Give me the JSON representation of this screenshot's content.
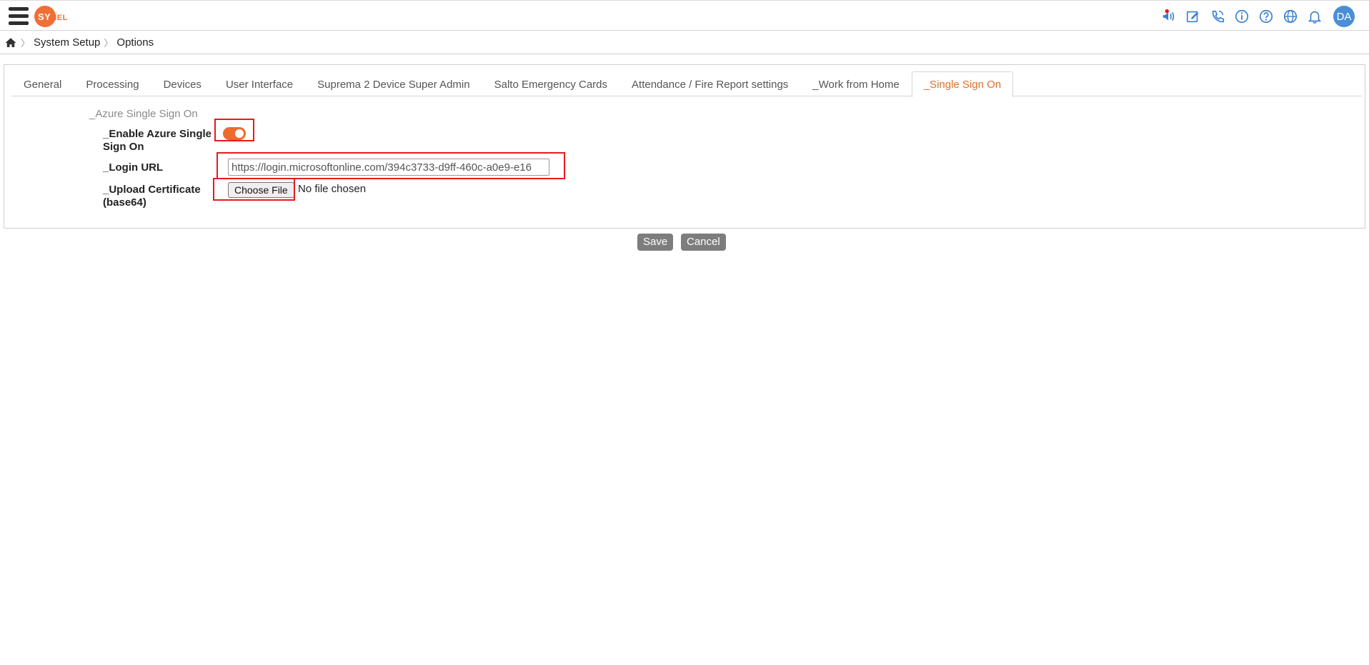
{
  "header": {
    "logo_text": "SY",
    "logo_tail": "NEL",
    "icons": [
      "announcement-icon",
      "edit-note-icon",
      "phone-icon",
      "info-icon",
      "help-icon",
      "globe-icon",
      "bell-icon"
    ],
    "avatar_initials": "DA",
    "accent_color": "#f06f35",
    "avatar_color": "#4a8fd6"
  },
  "breadcrumb": {
    "items": [
      "System Setup",
      "Options"
    ]
  },
  "tabs": [
    {
      "label": "General",
      "active": false
    },
    {
      "label": "Processing",
      "active": false
    },
    {
      "label": "Devices",
      "active": false
    },
    {
      "label": "User Interface",
      "active": false
    },
    {
      "label": "Suprema 2 Device Super Admin",
      "active": false
    },
    {
      "label": "Salto Emergency Cards",
      "active": false
    },
    {
      "label": "Attendance / Fire Report settings",
      "active": false
    },
    {
      "label": "_Work from Home",
      "active": false
    },
    {
      "label": "_Single Sign On",
      "active": true
    }
  ],
  "sso": {
    "section_title": "_Azure Single Sign On",
    "enable_label": "_Enable Azure Single Sign On",
    "enable_value": true,
    "login_url_label": "_Login URL",
    "login_url_value": "https://login.microsoftonline.com/394c3733-d9ff-460c-a0e9-e16",
    "upload_label": "_Upload Certificate (base64)",
    "choose_file_label": "Choose File",
    "file_status": "No file chosen"
  },
  "actions": {
    "save_label": "Save",
    "cancel_label": "Cancel"
  },
  "colors": {
    "active_tab": "#e0702a",
    "toggle_on": "#ef6a2f",
    "highlight": "#e51b1b"
  }
}
